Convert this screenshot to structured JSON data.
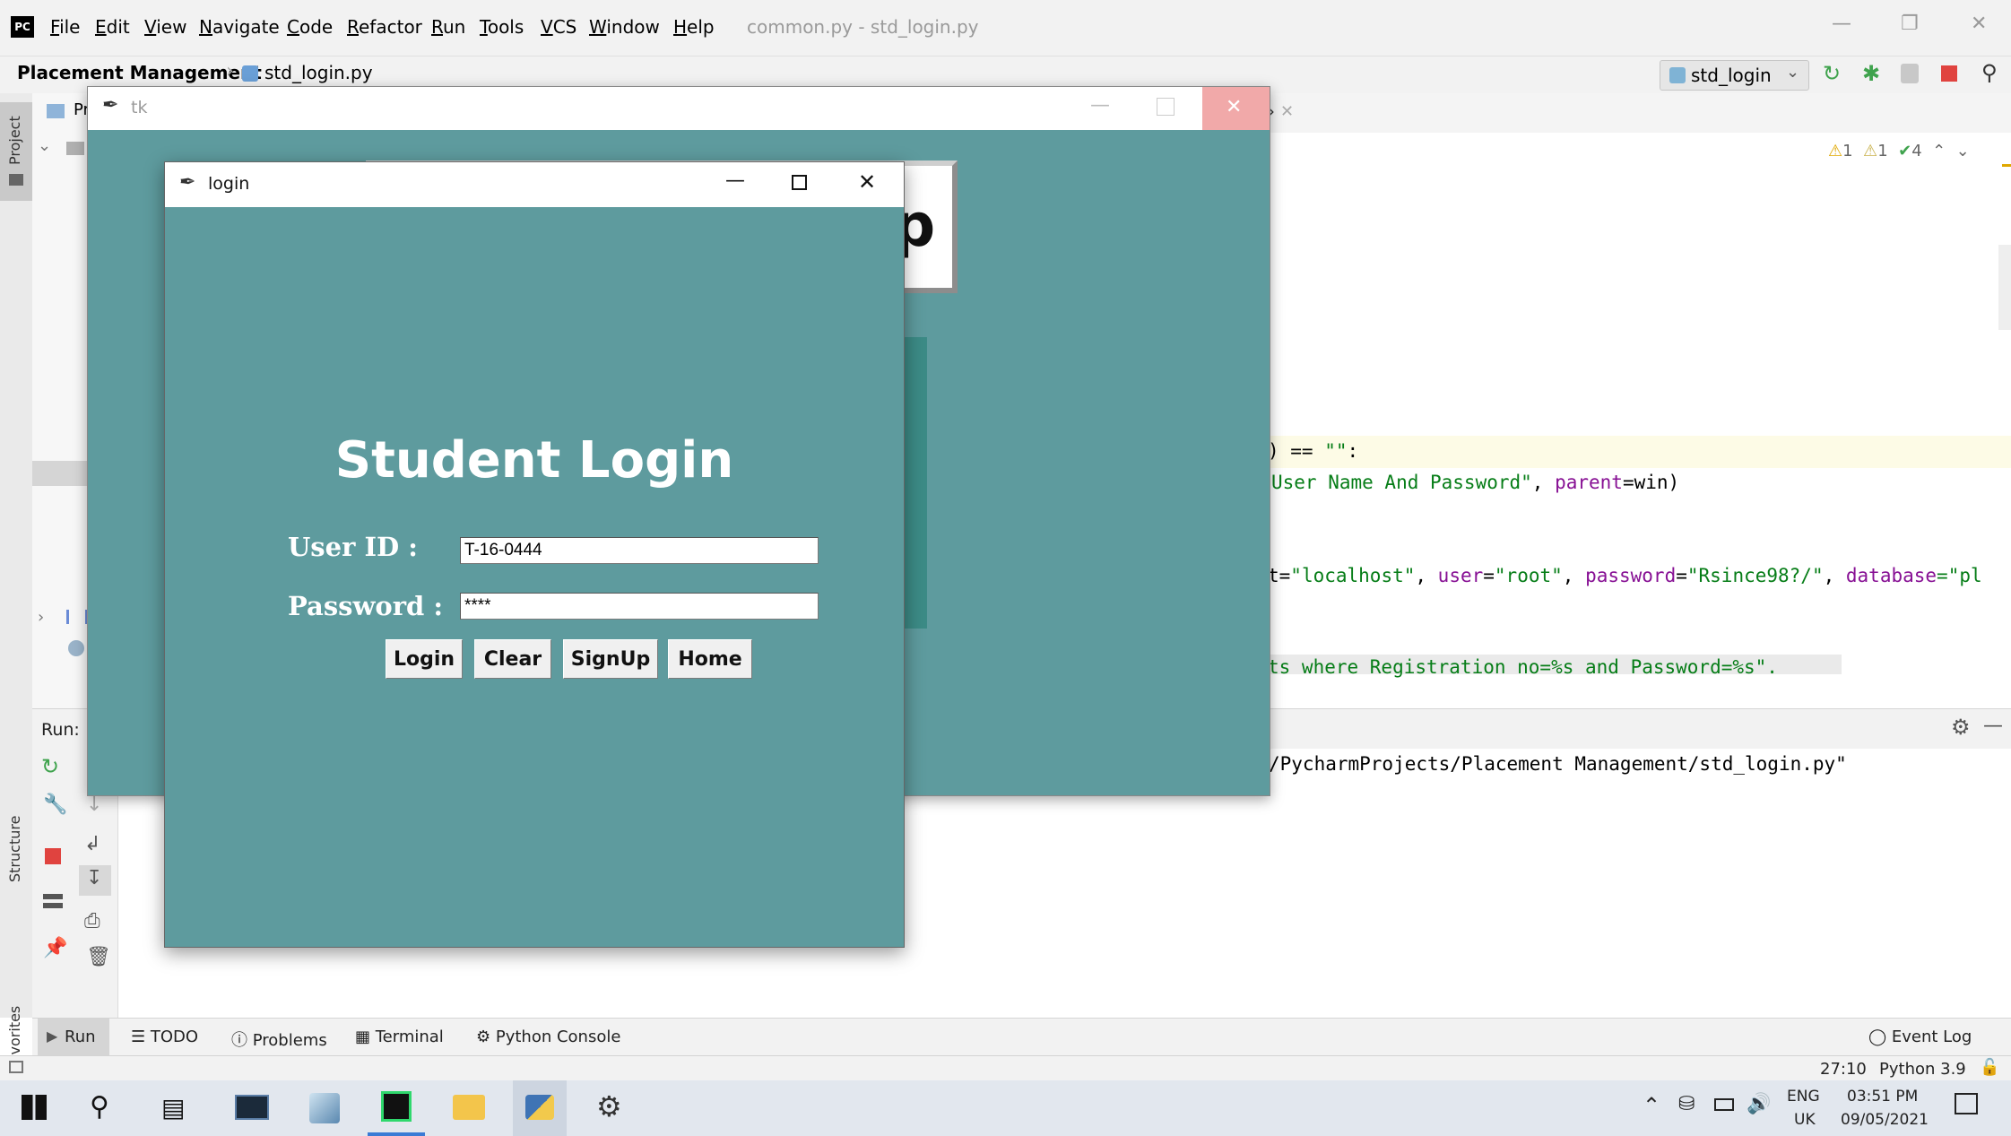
{
  "ide": {
    "logo_text": "PC",
    "menu": [
      "File",
      "Edit",
      "View",
      "Navigate",
      "Code",
      "Refactor",
      "Run",
      "Tools",
      "VCS",
      "Window",
      "Help"
    ],
    "window_title": "common.py - std_login.py",
    "breadcrumb_project": "Placement Management",
    "breadcrumb_file": "std_login.py",
    "run_config": "std_login",
    "inspections": {
      "warnings": "1",
      "weak_warnings": "1",
      "typos": "4"
    },
    "left_tabs": {
      "project": "Project",
      "structure": "Structure",
      "favorites": "Favorites"
    },
    "project_tab_partial": "Pr",
    "code_lines": {
      "line1_a": ") == ",
      "line1_str": "\"\"",
      "line1_b": ":",
      "line2_str": "User Name And Password\"",
      "line2_b": ", ",
      "line2_kw": "parent",
      "line2_c": "=win)",
      "line3_a": "t=",
      "line3_s1": "\"localhost\"",
      "line3_b": ", ",
      "line3_k1": "user",
      "line3_c": "=",
      "line3_s2": "\"root\"",
      "line3_d": ", ",
      "line3_k2": "password",
      "line3_e": "=",
      "line3_s3": "\"Rsince98?/\"",
      "line3_f": ", ",
      "line3_k3": "database",
      "line3_g": "=\"pl",
      "line4_str": "ts where Registration no=%s and Password=%s\"."
    },
    "run_label": "Run:",
    "run_output": "/PycharmProjects/Placement Management/std_login.py\"",
    "bottom_tabs": {
      "run": "Run",
      "todo": "TODO",
      "problems": "Problems",
      "terminal": "Terminal",
      "python_console": "Python Console",
      "event_log": "Event Log"
    },
    "status": {
      "position": "27:10",
      "interpreter": "Python 3.9"
    }
  },
  "tk_window": {
    "title": "tk",
    "bg_letter": "p"
  },
  "login_window": {
    "title": "login",
    "heading": "Student Login",
    "user_id_label": "User ID :",
    "user_id_value": "T-16-0444",
    "password_label": "Password :",
    "password_value": "****",
    "buttons": {
      "login": "Login",
      "clear": "Clear",
      "signup": "SignUp",
      "home": "Home"
    },
    "bg_color": "#5e9b9e"
  },
  "taskbar": {
    "lang_top": "ENG",
    "lang_bottom": "UK",
    "time": "03:51 PM",
    "date": "09/05/2021"
  }
}
